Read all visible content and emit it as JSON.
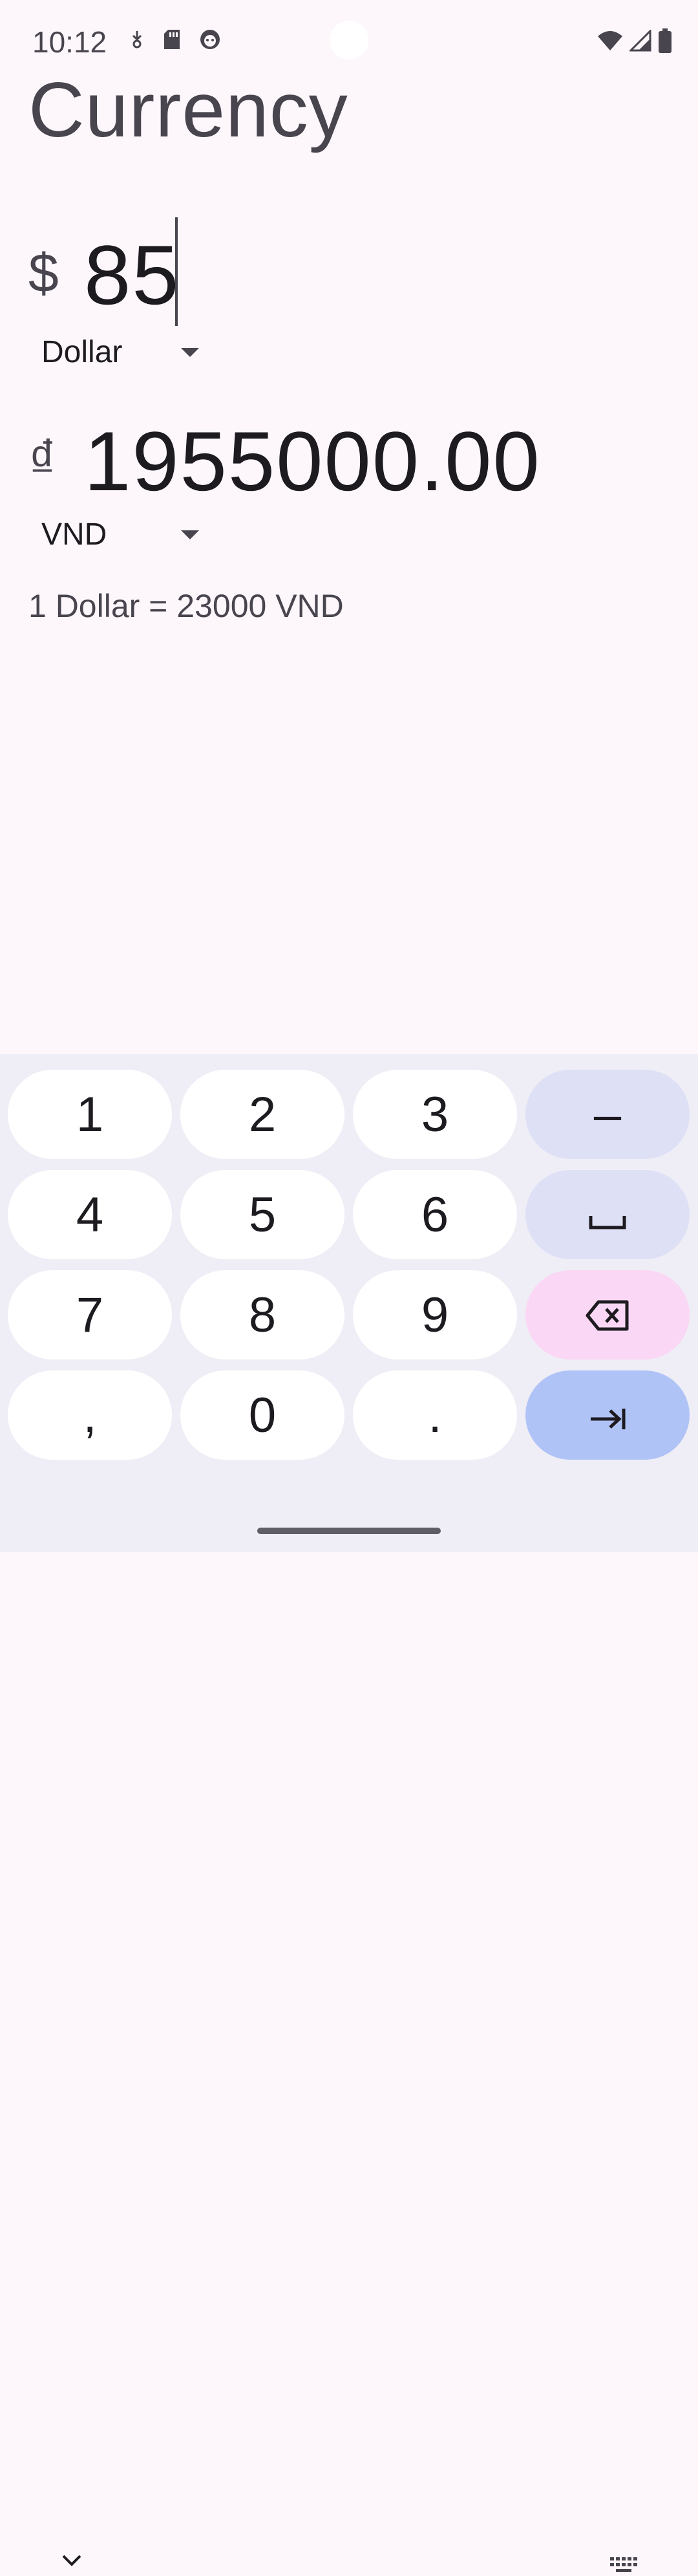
{
  "status_bar": {
    "time": "10:12",
    "left_icons": [
      "download-icon",
      "sd-card-icon",
      "face-icon"
    ],
    "right_icons": [
      "wifi-icon",
      "signal-icon",
      "battery-icon"
    ]
  },
  "title": "Currency",
  "from": {
    "symbol": "$",
    "amount": "85",
    "currency": "Dollar"
  },
  "to": {
    "symbol": "₫",
    "amount": "1955000.00",
    "currency": "VND"
  },
  "rate_text": "1 Dollar = 23000 VND",
  "keyboard": {
    "keys": {
      "k1": "1",
      "k2": "2",
      "k3": "3",
      "minus": "–",
      "k4": "4",
      "k5": "5",
      "k6": "6",
      "k7": "7",
      "k8": "8",
      "k9": "9",
      "comma": ",",
      "k0": "0",
      "dot": "."
    },
    "icons": [
      "space-icon",
      "backspace-icon",
      "tab-enter-icon",
      "hide-keyboard-icon",
      "keyboard-switch-icon"
    ]
  },
  "colors": {
    "background": "#fdf7fc",
    "keyboard_bg": "#efeef6",
    "key": "#ffffff",
    "mod_key": "#dee0f6",
    "delete_key": "#fad7f4",
    "enter_key": "#b0c3f7"
  }
}
